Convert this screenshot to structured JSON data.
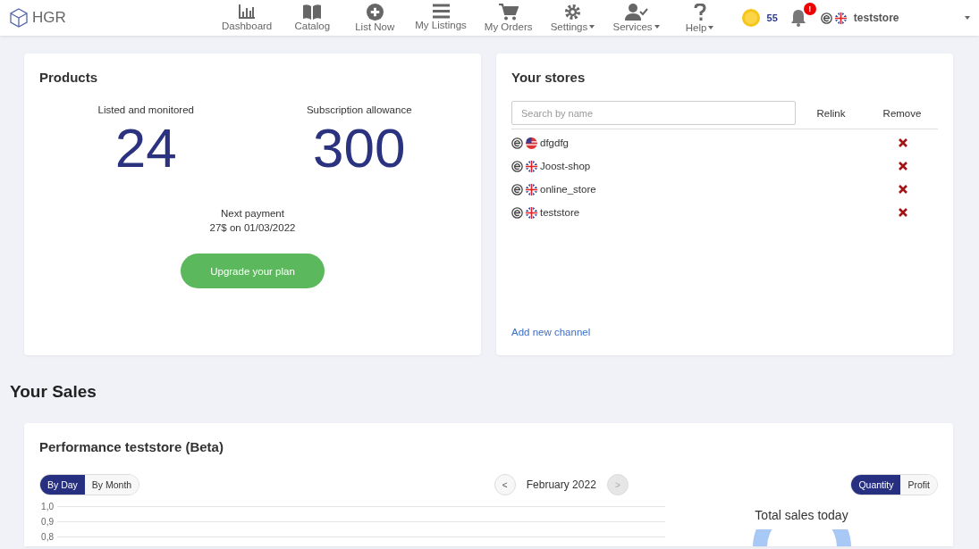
{
  "brand": {
    "name": "HGR"
  },
  "nav": [
    {
      "label": "Dashboard",
      "dropdown": false
    },
    {
      "label": "Catalog",
      "dropdown": false
    },
    {
      "label": "List Now",
      "dropdown": false
    },
    {
      "label": "My Listings",
      "dropdown": false
    },
    {
      "label": "My Orders",
      "dropdown": false
    },
    {
      "label": "Settings",
      "dropdown": true
    },
    {
      "label": "Services",
      "dropdown": true
    },
    {
      "label": "Help",
      "dropdown": true
    }
  ],
  "coins": "55",
  "notifications": {
    "badge": "!"
  },
  "account": {
    "name": "teststore"
  },
  "products": {
    "title": "Products",
    "stats": [
      {
        "label": "Listed and monitored",
        "value": "24"
      },
      {
        "label": "Subscription allowance",
        "value": "300"
      }
    ],
    "next_payment_label": "Next payment",
    "next_payment": "27$ on 01/03/2022",
    "upgrade": "Upgrade your plan"
  },
  "stores": {
    "title": "Your stores",
    "search": {
      "placeholder": "Search by name"
    },
    "columns": [
      "Relink",
      "Remove"
    ],
    "rows": [
      {
        "name": "dfgdfg",
        "kind": "us"
      },
      {
        "name": "Joost-shop",
        "kind": "uk"
      },
      {
        "name": "online_store",
        "kind": "uk"
      },
      {
        "name": "teststore",
        "kind": "uk"
      }
    ],
    "add_link": "Add new channel"
  },
  "sales_title": "Your Sales",
  "performance": {
    "title": "Performance teststore (Beta)",
    "period_tabs": [
      {
        "label": "By Day",
        "selected": true
      },
      {
        "label": "By Month",
        "selected": false
      }
    ],
    "prev": "<",
    "month": "February 2022",
    "next": {
      "label": ">",
      "disabled": true
    },
    "metric_tabs": [
      {
        "label": "Quantity",
        "selected": true
      },
      {
        "label": "Profit",
        "selected": false
      }
    ],
    "y_labels": [
      "1,0",
      "0,9",
      "0,8"
    ],
    "total_title": "Total sales today"
  }
}
